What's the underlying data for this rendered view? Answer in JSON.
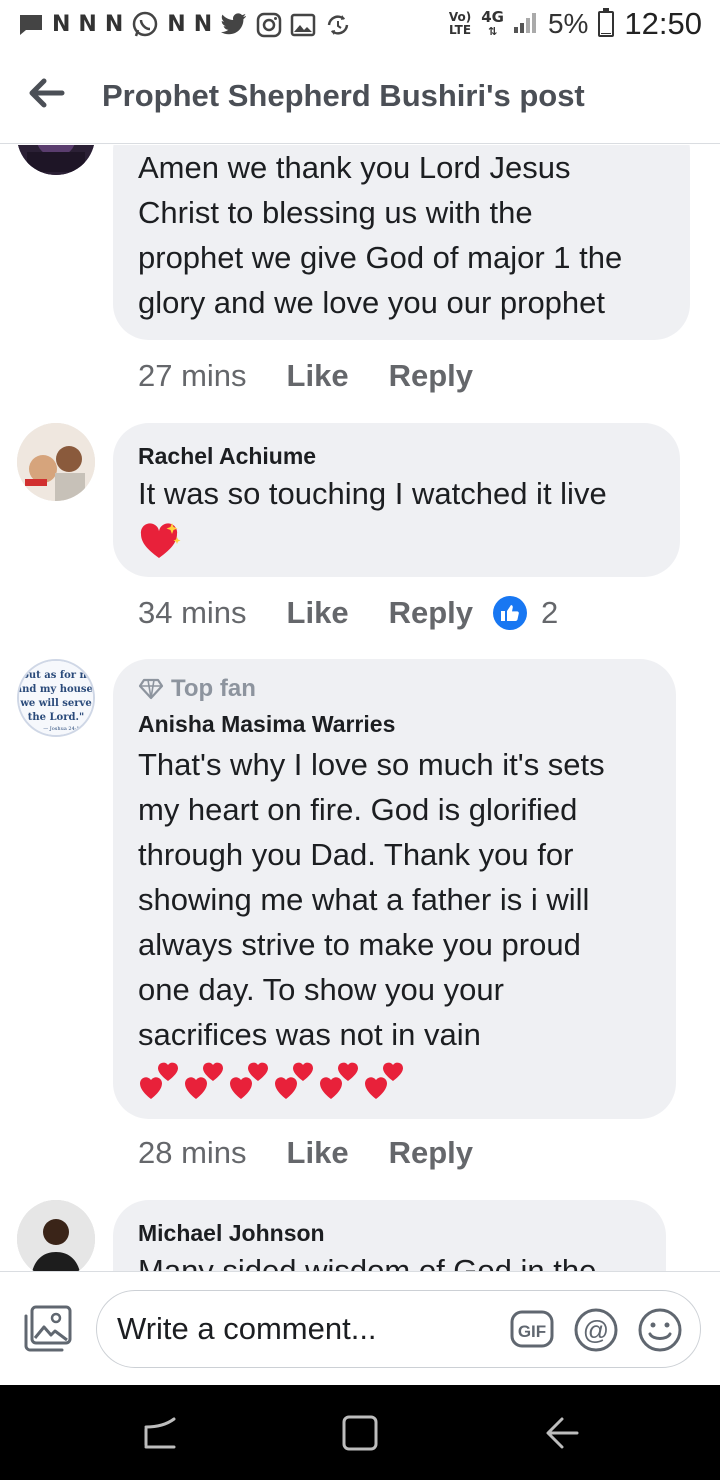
{
  "status_bar": {
    "volte": "Vo)\nLTE",
    "network": "4G",
    "battery": "5%",
    "time": "12:50",
    "icons": [
      "message-icon",
      "n-icon",
      "n-icon",
      "n-icon",
      "whatsapp-icon",
      "n-icon",
      "n-icon",
      "twitter-icon",
      "instagram-icon",
      "gallery-icon",
      "sync-icon"
    ]
  },
  "header": {
    "title": "Prophet Shepherd Bushiri's post",
    "back_icon": "back-arrow-icon"
  },
  "comments": [
    {
      "author": "",
      "text": "Amen we thank you Lord Jesus\nChrist to blessing us with the\nprophet we give God of major 1 the\nglory and we love you our prophet",
      "time": "27 mins",
      "like_label": "Like",
      "reply_label": "Reply"
    },
    {
      "author": "Rachel Achiume",
      "text": "It was so touching I watched it live",
      "emoji": "sparkling-heart",
      "time": "34 mins",
      "like_label": "Like",
      "reply_label": "Reply",
      "reaction_count": "2"
    },
    {
      "badge": "Top fan",
      "author": "Anisha Masima Warries",
      "text": "That's why I love so much it's sets\nmy heart on fire. God is glorified\nthrough you Dad. Thank you for\nshowing me what a father is i will\nalways strive to make you proud\none day. To show you your\nsacrifices was not in vain",
      "emoji": "two-hearts x6",
      "avatar_text": "but as for me and my house, we will serve the Lord.\" — Joshua 24:15",
      "time": "28 mins",
      "like_label": "Like",
      "reply_label": "Reply"
    },
    {
      "author": "Michael Johnson",
      "text": "Many sided wisdom of God in the"
    }
  ],
  "composer": {
    "placeholder": "Write a comment...",
    "gif_label": "GIF",
    "at_label": "@"
  },
  "colors": {
    "bubble": "#eff0f3",
    "meta": "#65676b",
    "like_blue": "#1877f2",
    "heart_red": "#e8213a"
  }
}
